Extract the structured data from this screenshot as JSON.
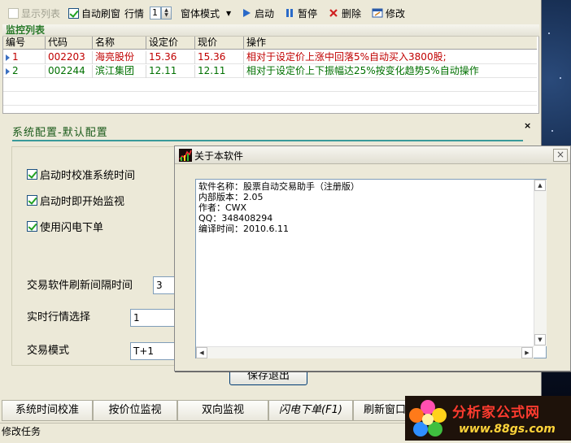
{
  "toolbar": {
    "show_list": "显示列表",
    "auto_refresh": "自动刷窗",
    "quote_label": "行情",
    "quote_value": "1",
    "window_mode": "窗体模式",
    "start": "启动",
    "pause": "暂停",
    "delete": "删除",
    "edit": "修改"
  },
  "monitor": {
    "title": "监控列表",
    "headers": [
      "编号",
      "代码",
      "名称",
      "设定价",
      "现价",
      "操作"
    ],
    "rows": [
      {
        "id": "1",
        "code": "002203",
        "name": "海亮股份",
        "set_price": "15.36",
        "price": "15.36",
        "action": "相对于设定价上涨中回落5%自动买入3800股;"
      },
      {
        "id": "2",
        "code": "002244",
        "name": "滨江集团",
        "set_price": "12.11",
        "price": "12.11",
        "action": "相对于设定价上下振幅达25%按变化趋势5%自动操作"
      }
    ]
  },
  "config": {
    "title": "系统配置-默认配置",
    "close": "×",
    "sync_time": "启动时校准系统时间",
    "start_monitor": "启动时即开始监视",
    "flash_order": "使用闪电下单",
    "refresh_interval_label": "交易软件刷新间隔时间",
    "refresh_interval_value": "3",
    "quote_select_label": "实时行情选择",
    "quote_select_value": "1",
    "trade_mode_label": "交易模式",
    "trade_mode_value": "T+1",
    "save_exit": "保存退出"
  },
  "tabs": [
    "系统时间校准",
    "按价位监视",
    "双向监视",
    "闪电下单(F1)",
    "刷新窗口"
  ],
  "status": "修改任务",
  "about": {
    "title": "关于本软件",
    "close": "×",
    "lines": [
      "软件名称：股票自动交易助手（注册版）",
      "内部版本：2.05",
      "作者：CWX",
      "QQ：348408294",
      "编译时间：2010.6.11"
    ]
  },
  "watermark": {
    "name": "分析家公式网",
    "url": "www.88gs.com"
  },
  "colors": {
    "rise": "#c00000",
    "neutral": "#007000",
    "accent": "#3a9a9a"
  }
}
